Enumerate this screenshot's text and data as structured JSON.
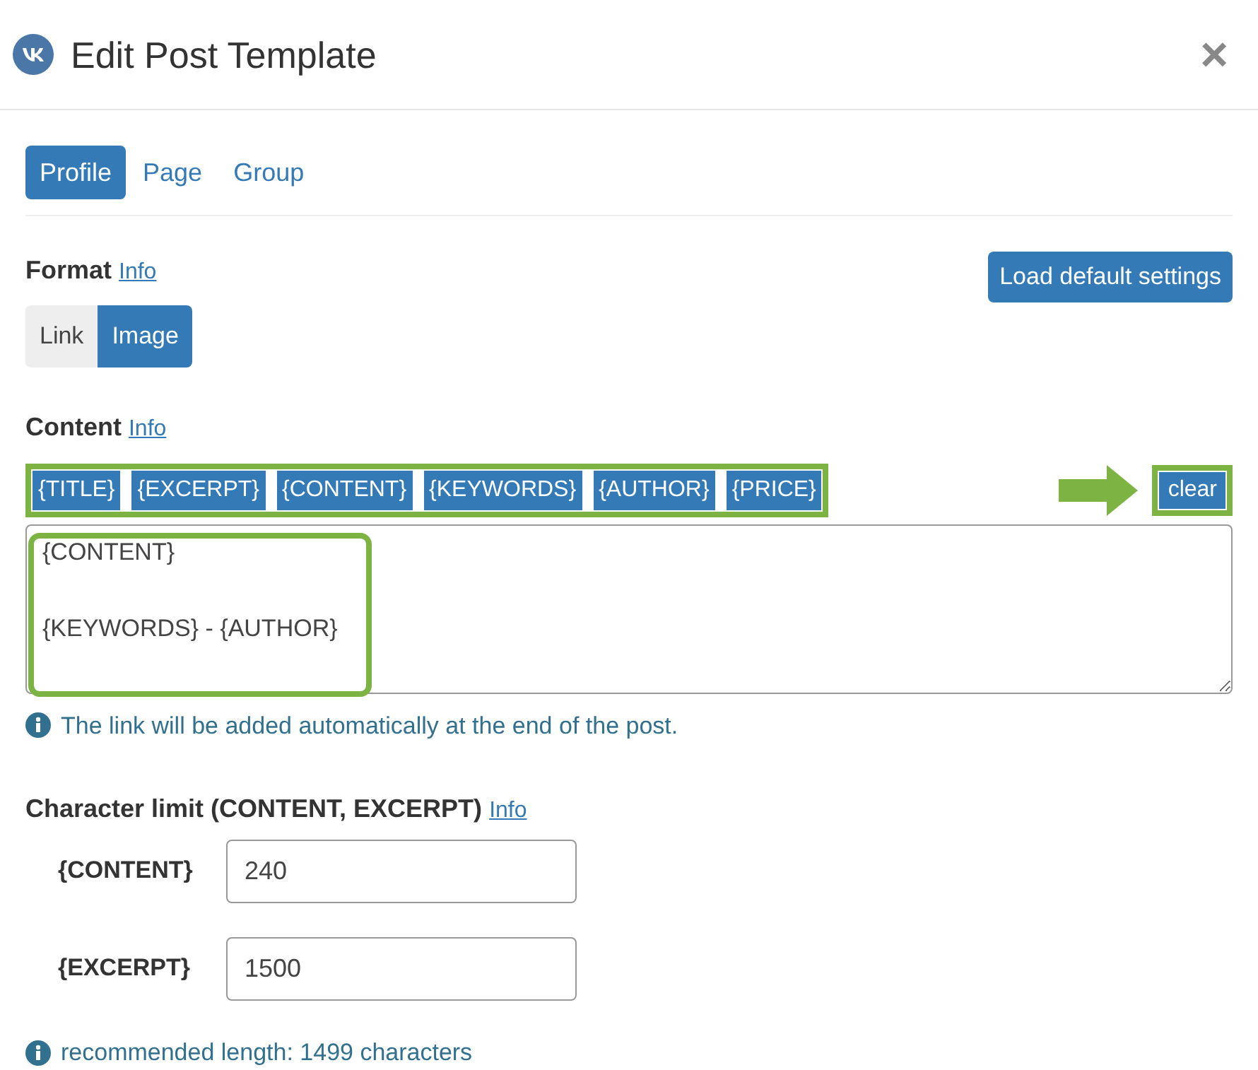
{
  "window": {
    "title": "Edit Post Template",
    "close": "×"
  },
  "tabs": [
    {
      "label": "Profile",
      "selected": true
    },
    {
      "label": "Page",
      "selected": false
    },
    {
      "label": "Group",
      "selected": false
    }
  ],
  "format": {
    "label": "Format",
    "info": "Info",
    "options": [
      {
        "label": "Link",
        "selected": false
      },
      {
        "label": "Image",
        "selected": true
      }
    ]
  },
  "load_default_button": "Load default settings",
  "content": {
    "label": "Content",
    "info": "Info",
    "tags": [
      "{TITLE}",
      "{EXCERPT}",
      "{CONTENT}",
      "{KEYWORDS}",
      "{AUTHOR}",
      "{PRICE}"
    ],
    "clear": "clear",
    "value": "{CONTENT}\n\n{KEYWORDS} - {AUTHOR}",
    "help": "The link will be added automatically at the end of the post."
  },
  "character_limit": {
    "label": "Character limit (CONTENT, EXCERPT)",
    "info": "Info",
    "fields": [
      {
        "label": "{CONTENT}",
        "value": "240"
      },
      {
        "label": "{EXCERPT}",
        "value": "1500"
      }
    ],
    "help": "recommended length: 1499 characters"
  }
}
